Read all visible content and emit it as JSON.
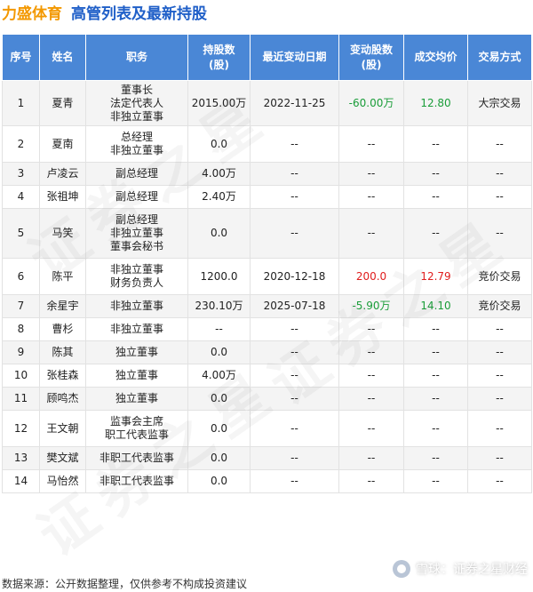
{
  "header": {
    "company": "力盛体育",
    "subtitle": "高管列表及最新持股"
  },
  "table": {
    "columns": [
      "序号",
      "姓名",
      "职务",
      "持股数\n(股)",
      "最近变动日期",
      "变动股数\n(股)",
      "成交均价",
      "交易方式"
    ],
    "rows": [
      {
        "no": "1",
        "name": "夏青",
        "position": "董事长\n法定代表人\n非独立董事",
        "shares": "2015.00万",
        "date": "2022-11-25",
        "change": "-60.00万",
        "change_sign": "neg",
        "price": "12.80",
        "price_sign": "neg",
        "method": "大宗交易"
      },
      {
        "no": "2",
        "name": "夏南",
        "position": "总经理\n非独立董事",
        "shares": "0.0",
        "date": "--",
        "change": "--",
        "change_sign": "",
        "price": "--",
        "price_sign": "",
        "method": "--"
      },
      {
        "no": "3",
        "name": "卢凌云",
        "position": "副总经理",
        "shares": "4.00万",
        "date": "--",
        "change": "--",
        "change_sign": "",
        "price": "--",
        "price_sign": "",
        "method": "--"
      },
      {
        "no": "4",
        "name": "张祖坤",
        "position": "副总经理",
        "shares": "2.40万",
        "date": "--",
        "change": "--",
        "change_sign": "",
        "price": "--",
        "price_sign": "",
        "method": "--"
      },
      {
        "no": "5",
        "name": "马笑",
        "position": "副总经理\n非独立董事\n董事会秘书",
        "shares": "0.0",
        "date": "--",
        "change": "--",
        "change_sign": "",
        "price": "--",
        "price_sign": "",
        "method": "--"
      },
      {
        "no": "6",
        "name": "陈平",
        "position": "非独立董事\n财务负责人",
        "shares": "1200.0",
        "date": "2020-12-18",
        "change": "200.0",
        "change_sign": "pos",
        "price": "12.79",
        "price_sign": "pos",
        "method": "竞价交易"
      },
      {
        "no": "7",
        "name": "余星宇",
        "position": "非独立董事",
        "shares": "230.10万",
        "date": "2025-07-18",
        "change": "-5.90万",
        "change_sign": "neg",
        "price": "14.10",
        "price_sign": "neg",
        "method": "竞价交易"
      },
      {
        "no": "8",
        "name": "曹杉",
        "position": "非独立董事",
        "shares": "--",
        "date": "--",
        "change": "--",
        "change_sign": "",
        "price": "--",
        "price_sign": "",
        "method": "--"
      },
      {
        "no": "9",
        "name": "陈其",
        "position": "独立董事",
        "shares": "0.0",
        "date": "--",
        "change": "--",
        "change_sign": "",
        "price": "--",
        "price_sign": "",
        "method": "--"
      },
      {
        "no": "10",
        "name": "张桂森",
        "position": "独立董事",
        "shares": "4.00万",
        "date": "--",
        "change": "--",
        "change_sign": "",
        "price": "--",
        "price_sign": "",
        "method": "--"
      },
      {
        "no": "11",
        "name": "顾鸣杰",
        "position": "独立董事",
        "shares": "0.0",
        "date": "--",
        "change": "--",
        "change_sign": "",
        "price": "--",
        "price_sign": "",
        "method": "--"
      },
      {
        "no": "12",
        "name": "王文朝",
        "position": "监事会主席\n职工代表监事",
        "shares": "0.0",
        "date": "--",
        "change": "--",
        "change_sign": "",
        "price": "--",
        "price_sign": "",
        "method": "--"
      },
      {
        "no": "13",
        "name": "樊文斌",
        "position": "非职工代表监事",
        "shares": "0.0",
        "date": "--",
        "change": "--",
        "change_sign": "",
        "price": "--",
        "price_sign": "",
        "method": "--"
      },
      {
        "no": "14",
        "name": "马怡然",
        "position": "非职工代表监事",
        "shares": "0.0",
        "date": "--",
        "change": "--",
        "change_sign": "",
        "price": "--",
        "price_sign": "",
        "method": "--"
      }
    ]
  },
  "footer": {
    "source_note": "数据来源：公开数据整理，仅供参考不构成投资建议",
    "brand": "雪球：证券之星财经"
  },
  "watermark": "证券之星",
  "colors": {
    "company": "#f39800",
    "subtitle": "#1f5fc8",
    "header_bg": "#4a87d6",
    "negative": "#1a9d39",
    "positive": "#e01d1d"
  }
}
